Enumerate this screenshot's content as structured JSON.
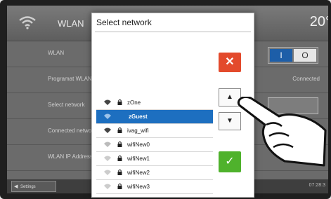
{
  "topbar": {
    "title": "WLAN",
    "temperature": "20°"
  },
  "rows": [
    {
      "label": "WLAN",
      "value": ""
    },
    {
      "label": "Programat WLAN",
      "value": "Connected"
    },
    {
      "label": "Select network",
      "value": ""
    },
    {
      "label": "Connected network",
      "value": ""
    },
    {
      "label": "WLAN IP Address",
      "value": ""
    }
  ],
  "toggle": {
    "on_label": "I",
    "off_label": "O"
  },
  "bottombar": {
    "back_label": "Settings",
    "time": "07:28:3"
  },
  "modal": {
    "title": "Select network",
    "close_symbol": "✕",
    "up_symbol": "▲",
    "down_symbol": "▼",
    "ok_symbol": "✓",
    "networks": [
      {
        "name": "zOne",
        "locked": true,
        "selected": false
      },
      {
        "name": "zGuest",
        "locked": false,
        "selected": true
      },
      {
        "name": "ivag_wifi",
        "locked": true,
        "selected": false
      },
      {
        "name": "wifiNew0",
        "locked": true,
        "selected": false
      },
      {
        "name": "wifiNew1",
        "locked": true,
        "selected": false
      },
      {
        "name": "wifiNew2",
        "locked": true,
        "selected": false
      },
      {
        "name": "wifiNew3",
        "locked": true,
        "selected": false
      }
    ]
  },
  "colors": {
    "accent": "#1d6fc0",
    "close": "#e34a2c",
    "ok": "#4fb22c"
  }
}
